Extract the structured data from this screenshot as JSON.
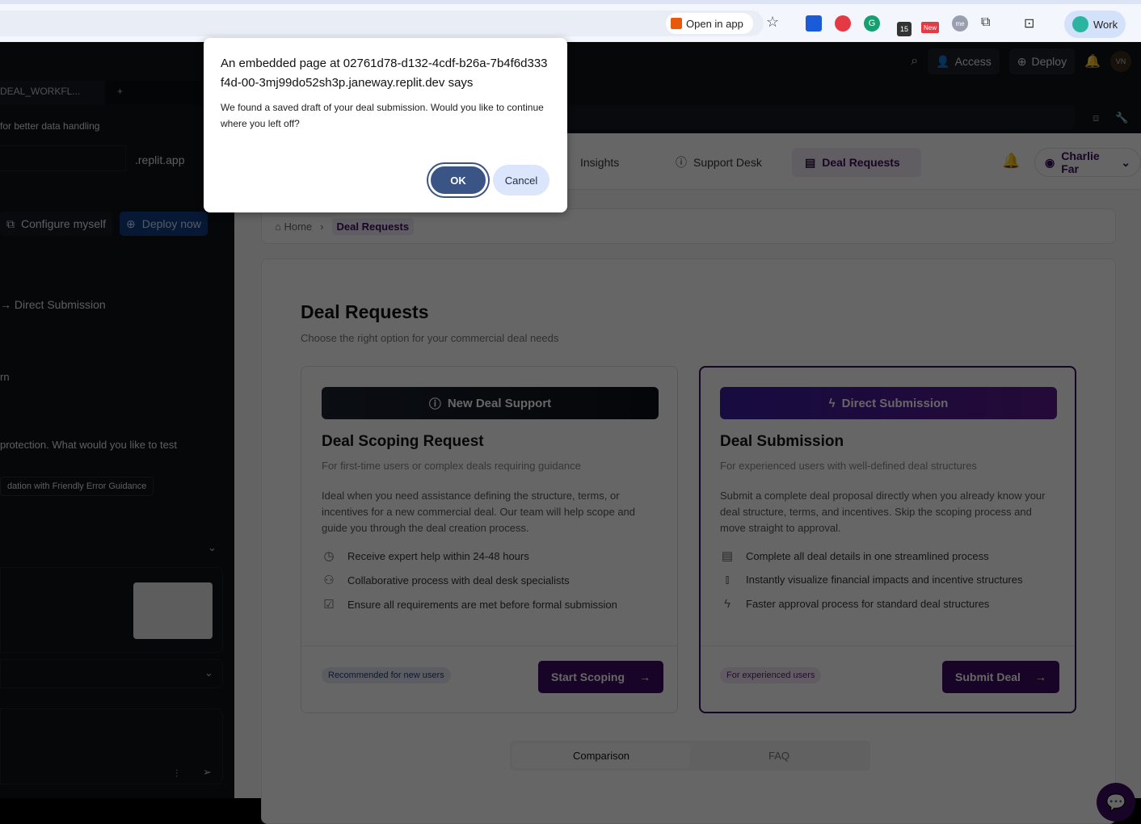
{
  "browser": {
    "open_in_app": "Open in app",
    "badge_count": "15",
    "badge_new": "New",
    "ext_me": "me",
    "profile": "Work"
  },
  "replit": {
    "access": "Access",
    "deploy": "Deploy",
    "avatar": "VN",
    "tab": "DEAL_WORKFL...",
    "tab_add": "+",
    "left_lines": [
      "for better data handling",
      ".replit.app",
      "Configure myself",
      "Deploy now",
      "→ Direct Submission",
      "rn",
      "protection. What would you like to test",
      "dation with Friendly Error Guidance"
    ]
  },
  "app": {
    "nav": [
      "Insights",
      "Support Desk",
      "Deal Requests"
    ],
    "user": "Charlie Far",
    "breadcrumb": {
      "home": "Home",
      "current": "Deal Requests"
    },
    "title": "Deal Requests",
    "subtitle": "Choose the right option for your commercial deal needs",
    "cards": [
      {
        "header": "New Deal Support",
        "title": "Deal Scoping Request",
        "desc": "For first-time users or complex deals requiring guidance",
        "body": "Ideal when you need assistance defining the structure, terms, or incentives for a new commercial deal. Our team will help scope and guide you through the deal creation process.",
        "features": [
          "Receive expert help within 24-48 hours",
          "Collaborative process with deal desk specialists",
          "Ensure all requirements are met before formal submission"
        ],
        "pill": "Recommended for new users",
        "action": "Start Scoping"
      },
      {
        "header": "Direct Submission",
        "title": "Deal Submission",
        "desc": "For experienced users with well-defined deal structures",
        "body": "Submit a complete deal proposal directly when you already know your deal structure, terms, and incentives. Skip the scoping process and move straight to approval.",
        "features": [
          "Complete all deal details in one streamlined process",
          "Instantly visualize financial impacts and incentive structures",
          "Faster approval process for standard deal structures"
        ],
        "pill": "For experienced users",
        "action": "Submit Deal"
      }
    ],
    "tabs": [
      "Comparison",
      "FAQ"
    ],
    "accent": "#3b0a5e"
  },
  "dialog": {
    "title": "An embedded page at 02761d78-d132-4cdf-b26a-7b4f6d333f4d-00-3mj99do52sh3p.janeway.replit.dev says",
    "message": "We found a saved draft of your deal submission. Would you like to continue where you left off?",
    "ok": "OK",
    "cancel": "Cancel"
  }
}
